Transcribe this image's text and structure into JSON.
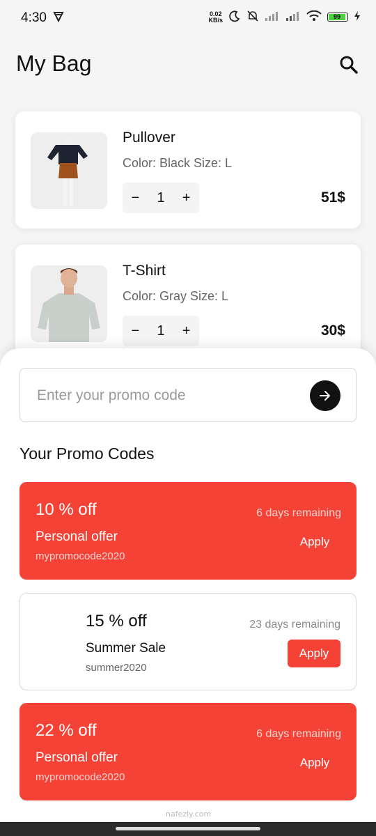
{
  "status": {
    "time": "4:30",
    "speed_value": "0.02",
    "speed_unit": "KB/s",
    "battery": "99"
  },
  "header": {
    "title": "My Bag",
    "search_icon": "search-icon"
  },
  "cart": {
    "items": [
      {
        "name": "Pullover",
        "meta": "Color: Black Size: L",
        "qty": "1",
        "price": "51$"
      },
      {
        "name": "T-Shirt",
        "meta": "Color: Gray Size: L",
        "qty": "1",
        "price": "30$"
      }
    ]
  },
  "promo": {
    "placeholder": "Enter your promo code",
    "section_title": "Your Promo Codes",
    "codes": [
      {
        "percent": "10 % off",
        "label": "Personal offer",
        "code": "mypromocode2020",
        "days": "6 days remaining",
        "apply": "Apply"
      },
      {
        "percent": "15 % off",
        "label": "Summer Sale",
        "code": "summer2020",
        "days": "23 days remaining",
        "apply": "Apply"
      },
      {
        "percent": "22 % off",
        "label": "Personal offer",
        "code": "mypromocode2020",
        "days": "6 days remaining",
        "apply": "Apply"
      }
    ]
  },
  "colors": {
    "accent": "#f44336",
    "dark": "#111111"
  },
  "watermark": "nafezly.com"
}
